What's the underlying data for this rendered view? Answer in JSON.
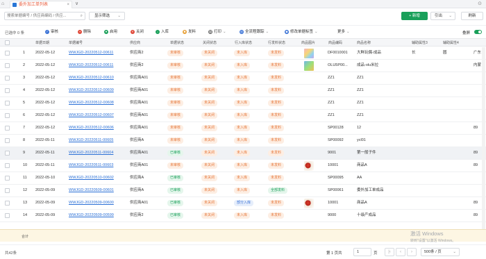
{
  "tabbar": {
    "tab_title": "委外加工单列表",
    "tab_close": "×",
    "new_tab": "∨",
    "right_icon": "⊙"
  },
  "toolbar": {
    "search_placeholder": "搜索单据编号 / 供应商编码 / 供应...",
    "filter_label": "显示筛选",
    "new_label": "+ 新增",
    "export_label": "引出",
    "refresh_label": "刷新"
  },
  "actions": {
    "selected_text": "已选中 0 条",
    "items": [
      {
        "label": "审核",
        "icon": "check-icon",
        "color": "#3a72d6",
        "glyph": "✓"
      },
      {
        "label": "删除",
        "icon": "trash-icon",
        "color": "#e04a3a",
        "glyph": "▪"
      },
      {
        "label": "启用",
        "icon": "enable-icon",
        "color": "#1aa05a",
        "glyph": "●"
      },
      {
        "label": "关闭",
        "icon": "close-circle-icon",
        "color": "#e04a3a",
        "glyph": "×"
      },
      {
        "label": "入库",
        "icon": "inbound-icon",
        "color": "#1aa05a",
        "glyph": "↓"
      },
      {
        "label": "发料",
        "icon": "issue-icon",
        "color": "#e8a23a",
        "glyph": "■"
      },
      {
        "label": "打印",
        "icon": "print-icon",
        "color": "#666666",
        "glyph": "▤"
      },
      {
        "label": "全流程跟踪",
        "icon": "track-icon",
        "color": "#3a72d6",
        "glyph": "◎"
      },
      {
        "label": "修改单据标签",
        "icon": "tag-icon",
        "color": "#3a72d6",
        "glyph": "◆"
      },
      {
        "label": "更多",
        "icon": "more-icon",
        "color": "#666666",
        "glyph": ""
      }
    ],
    "fold_label": "叠屏"
  },
  "columns": [
    "单据日期",
    "单据编号",
    "供应商",
    "单据状态",
    "关闭状态",
    "行入库状态",
    "行发料状态",
    "商品图片",
    "商品编码",
    "商品名称",
    "辅助属性3",
    "辅助属性4"
  ],
  "rows": [
    {
      "no": "1",
      "date": "2022-05-12",
      "code": "WWJGD-20220512-00611",
      "supplier": "供应商2",
      "status": "未审核",
      "status_color": "orange",
      "close": "未关闭",
      "in": "未入库",
      "issue": "未发料",
      "issue_color": "orange",
      "img": "a",
      "sku": "DF0010001",
      "name": "大鲜玩偶-成品",
      "a3": "长",
      "a4": "圆",
      "extra": "广东"
    },
    {
      "no": "2",
      "date": "2022-05-12",
      "code": "WWJGD-20220512-00611",
      "supplier": "供应商2",
      "status": "未审核",
      "status_color": "orange",
      "close": "未关闭",
      "in": "未入库",
      "issue": "未发料",
      "issue_color": "orange",
      "img": "b",
      "sku": "OLU5P00...",
      "name": "成品-olu米拉",
      "a3": "",
      "a4": "",
      "extra": "内蒙"
    },
    {
      "no": "3",
      "date": "2022-05-12",
      "code": "WWJGD-20220512-00610",
      "supplier": "供应商A01",
      "status": "未审核",
      "status_color": "orange",
      "close": "未关闭",
      "in": "未入库",
      "issue": "未发料",
      "issue_color": "orange",
      "img": "",
      "sku": "ZZ1",
      "name": "ZZ1",
      "a3": "",
      "a4": "",
      "extra": ""
    },
    {
      "no": "4",
      "date": "2022-05-12",
      "code": "WWJGD-20220512-00609",
      "supplier": "供应商A01",
      "status": "未审核",
      "status_color": "orange",
      "close": "未关闭",
      "in": "未入库",
      "issue": "未发料",
      "issue_color": "orange",
      "img": "",
      "sku": "ZZ1",
      "name": "ZZ1",
      "a3": "",
      "a4": "",
      "extra": ""
    },
    {
      "no": "5",
      "date": "2022-05-12",
      "code": "WWJGD-20220512-00608",
      "supplier": "供应商A01",
      "status": "未审核",
      "status_color": "orange",
      "close": "未关闭",
      "in": "未入库",
      "issue": "未发料",
      "issue_color": "orange",
      "img": "",
      "sku": "ZZ1",
      "name": "ZZ1",
      "a3": "",
      "a4": "",
      "extra": ""
    },
    {
      "no": "6",
      "date": "2022-05-12",
      "code": "WWJGD-20220512-00607",
      "supplier": "供应商A01",
      "status": "未审核",
      "status_color": "orange",
      "close": "未关闭",
      "in": "未入库",
      "issue": "未发料",
      "issue_color": "orange",
      "img": "",
      "sku": "ZZ1",
      "name": "ZZ1",
      "a3": "",
      "a4": "",
      "extra": ""
    },
    {
      "no": "7",
      "date": "2022-05-12",
      "code": "WWJGD-20220512-00606",
      "supplier": "供应商A01",
      "status": "未审核",
      "status_color": "orange",
      "close": "未关闭",
      "in": "未入库",
      "issue": "未发料",
      "issue_color": "orange",
      "img": "",
      "sku": "SP00128",
      "name": "12",
      "a3": "",
      "a4": "",
      "extra": "89"
    },
    {
      "no": "8",
      "date": "2022-05-11",
      "code": "WWJGD-20220511-00605",
      "supplier": "供应商A",
      "status": "未审核",
      "status_color": "orange",
      "close": "未关闭",
      "in": "未入库",
      "issue": "未发料",
      "issue_color": "orange",
      "img": "",
      "sku": "SP00092",
      "name": "ycl01",
      "a3": "",
      "a4": "",
      "extra": ""
    },
    {
      "no": "9",
      "date": "2022-05-11",
      "code": "WWJGD-20220511-00604",
      "supplier": "供应商A01",
      "status": "已审核",
      "status_color": "green",
      "close": "未关闭",
      "in": "未入库",
      "issue": "未发料",
      "issue_color": "orange",
      "img": "",
      "sku": "9001",
      "name": "第一般子件",
      "a3": "",
      "a4": "",
      "extra": "89"
    },
    {
      "no": "10",
      "date": "2022-05-11",
      "code": "WWJGD-20220511-00603",
      "supplier": "供应商A01",
      "status": "未审核",
      "status_color": "orange",
      "close": "未关闭",
      "in": "未入库",
      "issue": "未发料",
      "issue_color": "orange",
      "img": "c",
      "sku": "10001",
      "name": "商品A",
      "a3": "",
      "a4": "",
      "extra": "89"
    },
    {
      "no": "11",
      "date": "2022-05-10",
      "code": "WWJGD-20220510-00602",
      "supplier": "供应商A",
      "status": "已审核",
      "status_color": "green",
      "close": "未关闭",
      "in": "未入库",
      "issue": "未发料",
      "issue_color": "orange",
      "img": "",
      "sku": "SP00095",
      "name": "AA",
      "a3": "",
      "a4": "",
      "extra": ""
    },
    {
      "no": "12",
      "date": "2022-05-09",
      "code": "WWJGD-20220509-00601",
      "supplier": "供应商A",
      "status": "已审核",
      "status_color": "green",
      "close": "未关闭",
      "in": "未入库",
      "issue": "全部发料",
      "issue_color": "green",
      "img": "",
      "sku": "SP00061",
      "name": "委外加工单成品",
      "a3": "",
      "a4": "",
      "extra": ""
    },
    {
      "no": "13",
      "date": "2022-05-09",
      "code": "WWJGD-20220509-00600",
      "supplier": "供应商A01",
      "status": "已审核",
      "status_color": "green",
      "close": "未关闭",
      "in": "部分入库",
      "issue": "未发料",
      "issue_color": "orange",
      "img": "c",
      "sku": "10001",
      "name": "商品A",
      "a3": "",
      "a4": "",
      "extra": "89"
    },
    {
      "no": "14",
      "date": "2022-05-09",
      "code": "WWJGD-20220509-00599",
      "supplier": "供应商2",
      "status": "已审核",
      "status_color": "green",
      "close": "未关闭",
      "in": "未入库",
      "issue": "未发料",
      "issue_color": "orange",
      "img": "",
      "sku": "9000",
      "name": "十级产成品",
      "a3": "",
      "a4": "",
      "extra": "89"
    }
  ],
  "summary_label": "合计",
  "footer": {
    "total": "共42条",
    "page_prefix": "第 1 页共",
    "page_value": "1",
    "page_suffix": "页",
    "page_size": "500条 / 页"
  },
  "watermark": {
    "line1": "激活 Windows",
    "line2": "转到\"设置\"以激活 Windows。"
  }
}
